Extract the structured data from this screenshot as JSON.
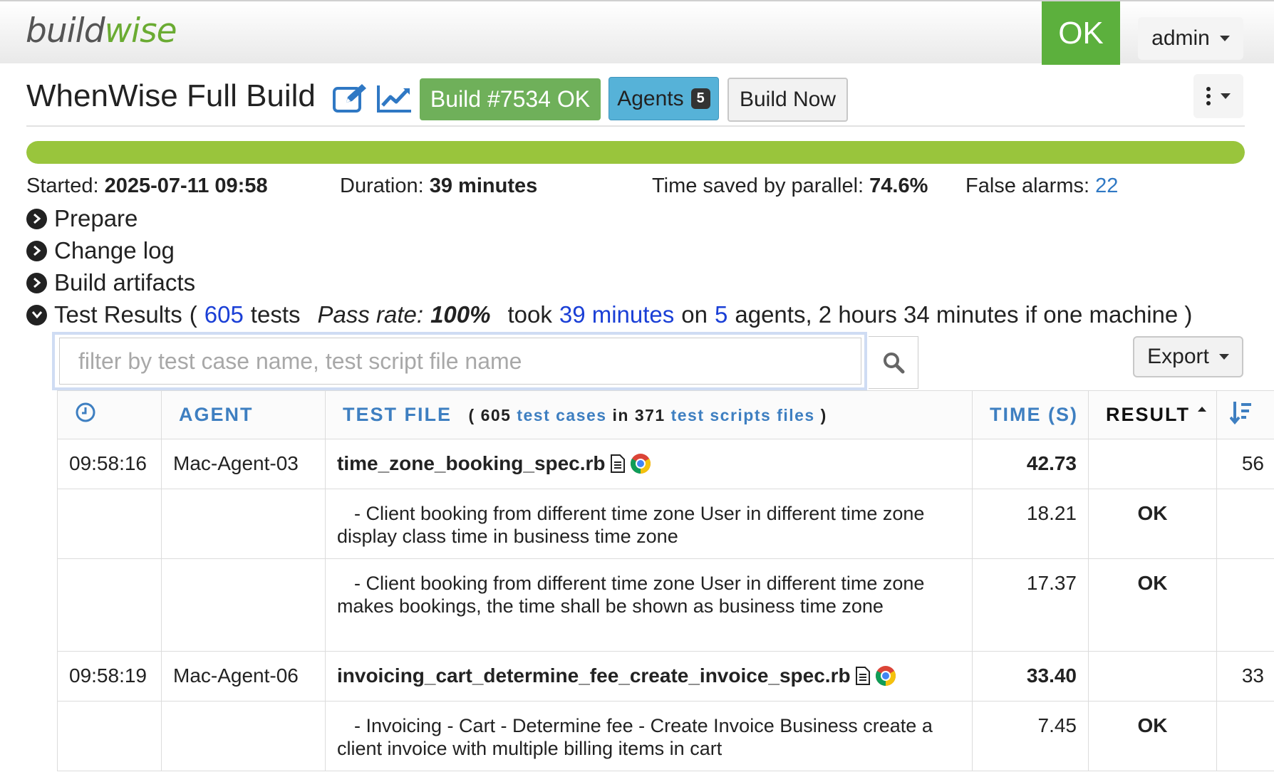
{
  "brand": {
    "b": "build",
    "w": "wise"
  },
  "status_badge": "OK",
  "user_menu": "admin",
  "page_title": "WhenWise Full Build",
  "buttons": {
    "build": "Build #7534 OK",
    "agents_label": "Agents",
    "agents_count": "5",
    "build_now": "Build Now",
    "export": "Export"
  },
  "progress": {
    "percent": 100,
    "color": "#99c53c"
  },
  "stats": {
    "started_label": "Started:",
    "started_value": "2025-07-11 09:58",
    "duration_label": "Duration:",
    "duration_value": "39 minutes",
    "parallel_label": "Time saved by parallel:",
    "parallel_value": "74.6%",
    "false_alarms_label": "False alarms:",
    "false_alarms_value": "22"
  },
  "sections": {
    "prepare": "Prepare",
    "changelog": "Change log",
    "artifacts": "Build artifacts",
    "results": "Test Results"
  },
  "results_summary": {
    "open": "(",
    "tests_count": "605",
    "tests_word": "tests",
    "pass_rate_label": "Pass rate:",
    "pass_rate_value": "100%",
    "took": "took",
    "took_value": "39 minutes",
    "on": "on",
    "agents_count": "5",
    "rest": "agents, 2 hours 34 minutes if one machine )"
  },
  "search": {
    "placeholder": "filter by test case name, test script file name"
  },
  "table": {
    "headers": {
      "agent": "AGENT",
      "test_file": "TEST FILE",
      "test_file_sub_open": "( 605",
      "test_file_sub_cases": "test cases",
      "test_file_sub_in": "in 371",
      "test_file_sub_scripts": "test scripts files",
      "test_file_sub_close": ")",
      "time": "TIME (S)",
      "result": "RESULT"
    },
    "rows": [
      {
        "time": "09:58:16",
        "agent": "Mac-Agent-03",
        "file": "time_zone_booking_spec.rb",
        "secs": "42.73",
        "result": "",
        "order": "56"
      },
      {
        "case": "- Client booking from different time zone User in different time zone display class time in business time zone",
        "secs": "18.21",
        "result": "OK"
      },
      {
        "case": "- Client booking from different time zone User in different time zone makes bookings, the time shall be shown as business time zone",
        "secs": "17.37",
        "result": "OK"
      },
      {
        "time": "09:58:19",
        "agent": "Mac-Agent-06",
        "file": "invoicing_cart_determine_fee_create_invoice_spec.rb",
        "secs": "33.40",
        "result": "",
        "order": "33"
      },
      {
        "case": "- Invoicing - Cart - Determine fee - Create Invoice Business create a client invoice with multiple billing items in cart",
        "secs": "7.45",
        "result": "OK"
      }
    ]
  },
  "icons": {
    "edit": "edit-icon",
    "chart": "line-chart-icon",
    "clock": "clock-icon",
    "search": "search-icon",
    "sort": "sort-icon",
    "doc": "document-icon",
    "chrome": "chrome-icon"
  }
}
